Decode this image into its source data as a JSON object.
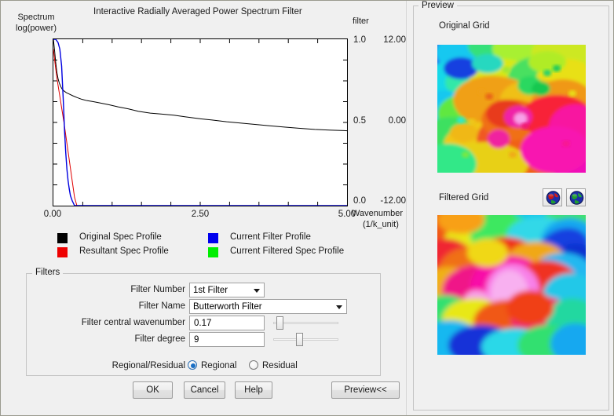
{
  "window": {
    "background": "#f0f0f0"
  },
  "chart": {
    "title": "Interactive Radially Averaged Power Spectrum Filter",
    "y_left_caption_line1": "Spectrum",
    "y_left_caption_line2": "log(power)",
    "y_right_caption": "filter",
    "x_caption_line1": "Wavenumber",
    "x_caption_line2": "(1/k_unit)",
    "y_left_ticks": [
      "12.00",
      "0.00",
      "-12.00"
    ],
    "y_right_ticks": [
      "1.0",
      "0.5",
      "0.0"
    ],
    "x_ticks": [
      "0.00",
      "2.50",
      "5.00"
    ]
  },
  "chart_data": {
    "type": "line",
    "title": "Interactive Radially Averaged Power Spectrum Filter",
    "xlabel": "Wavenumber (1/k_unit)",
    "ylabel": "Spectrum log(power)",
    "ylabel_right": "filter",
    "xlim": [
      0.0,
      5.0
    ],
    "ylim": [
      -12.0,
      12.0
    ],
    "ylim_right": [
      0.0,
      1.0
    ],
    "xticks": [
      0.0,
      2.5,
      5.0
    ],
    "yticks": [
      12.0,
      0.0,
      -12.0
    ],
    "yticks_right": [
      1.0,
      0.5,
      0.0
    ],
    "grid": false,
    "legend_position": "below-axes",
    "series": [
      {
        "name": "Original Spec Profile",
        "color": "#000000",
        "axis": "left",
        "x": [
          0.0,
          0.02,
          0.04,
          0.06,
          0.08,
          0.1,
          0.13,
          0.15,
          0.18,
          0.22,
          0.27,
          0.33,
          0.4,
          0.48,
          0.57,
          0.68,
          0.8,
          0.95,
          1.1,
          1.28,
          1.45,
          1.65,
          1.85,
          2.05,
          2.25,
          2.48,
          2.7,
          2.95,
          3.2,
          3.45,
          3.7,
          3.95,
          4.2,
          4.45,
          4.7,
          4.95,
          5.0
        ],
        "y": [
          12.0,
          10.4,
          8.6,
          7.2,
          6.3,
          5.7,
          5.1,
          4.8,
          4.55,
          4.3,
          4.1,
          3.85,
          3.6,
          3.35,
          3.15,
          3.0,
          2.8,
          2.55,
          2.25,
          1.95,
          1.6,
          1.35,
          1.2,
          1.05,
          0.8,
          0.55,
          0.35,
          0.1,
          -0.1,
          -0.3,
          -0.5,
          -0.68,
          -0.85,
          -1.0,
          -1.1,
          -1.18,
          -1.2
        ]
      },
      {
        "name": "Resultant Spec Profile",
        "color": "#e00000",
        "axis": "left",
        "x": [
          0.0,
          0.03,
          0.06,
          0.09,
          0.12,
          0.15,
          0.18,
          0.21,
          0.24,
          0.27,
          0.3,
          0.33,
          0.36,
          0.4,
          5.0
        ],
        "y": [
          10.6,
          8.4,
          6.4,
          4.8,
          3.2,
          1.6,
          0.0,
          -1.8,
          -3.6,
          -5.4,
          -7.2,
          -9.0,
          -10.8,
          -12.0,
          -12.0
        ]
      },
      {
        "name": "Current Filter Profile",
        "color": "#0000e0",
        "axis": "right",
        "x": [
          0.0,
          0.04,
          0.08,
          0.11,
          0.14,
          0.17,
          0.19,
          0.21,
          0.23,
          0.25,
          0.27,
          0.29,
          0.32,
          0.36,
          5.0
        ],
        "y": [
          1.0,
          1.0,
          0.98,
          0.94,
          0.84,
          0.62,
          0.45,
          0.32,
          0.22,
          0.15,
          0.1,
          0.06,
          0.03,
          0.0,
          0.0
        ]
      },
      {
        "name": "Current Filtered Spec Profile",
        "color": "#00e000",
        "axis": "left",
        "x": [],
        "y": []
      }
    ]
  },
  "legend": {
    "items": [
      {
        "label": "Original Spec Profile",
        "color": "#000000"
      },
      {
        "label": "Resultant Spec Profile",
        "color": "#ee0000"
      },
      {
        "label": "Current Filter Profile",
        "color": "#0000ee"
      },
      {
        "label": "Current Filtered Spec Profile",
        "color": "#00ee00"
      }
    ]
  },
  "filters": {
    "group_title": "Filters",
    "filter_number_label": "Filter Number",
    "filter_number_value": "1st Filter",
    "filter_name_label": "Filter Name",
    "filter_name_value": "Butterworth Filter",
    "central_wavenumber_label": "Filter central wavenumber",
    "central_wavenumber_value": "0.17",
    "degree_label": "Filter degree",
    "degree_value": "9",
    "regional_residual_label": "Regional/Residual",
    "regional_label": "Regional",
    "residual_label": "Residual",
    "selected": "Regional"
  },
  "buttons": {
    "ok": "OK",
    "cancel": "Cancel",
    "help": "Help",
    "preview": "Preview<<"
  },
  "preview": {
    "group_title": "Preview",
    "original_grid_label": "Original Grid",
    "filtered_grid_label": "Filtered Grid",
    "globe_red_icon": "globe-red-icon",
    "globe_green_icon": "globe-green-icon"
  }
}
